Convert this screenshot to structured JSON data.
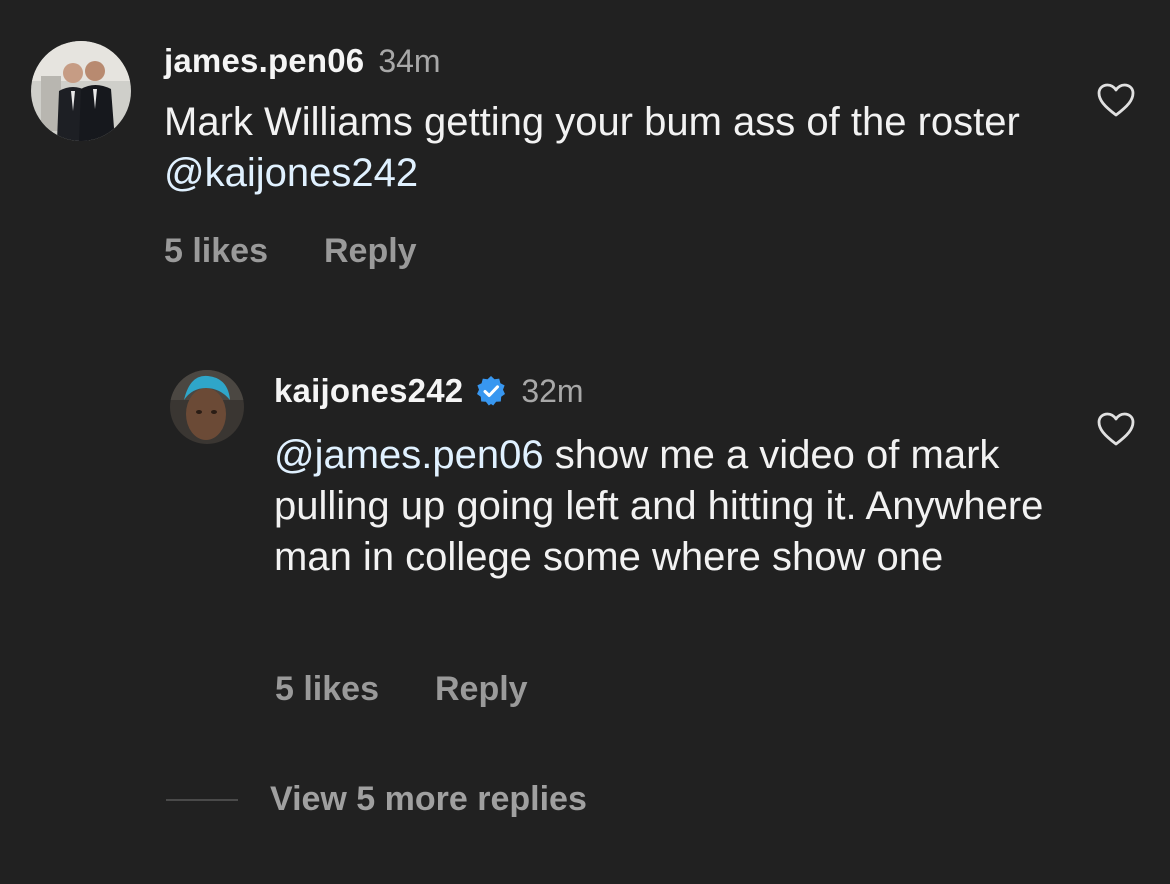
{
  "comments": [
    {
      "username": "james.pen06",
      "time": "34m",
      "text_before": "Mark Williams getting your bum ass of the roster ",
      "mention": "@kaijones242",
      "text_after": "",
      "likes": "5 likes",
      "reply_label": "Reply",
      "avatar": "two-men-in-suits-photo",
      "verified": false
    },
    {
      "username": "kaijones242",
      "time": "32m",
      "mention": "@james.pen06",
      "text_after": " show me a video of mark pulling up going left and hitting it. Anywhere man in college some where show one",
      "likes": "5 likes",
      "reply_label": "Reply",
      "avatar": "man-with-blue-hair-photo",
      "verified": true
    }
  ],
  "view_more_label": "View 5 more replies",
  "icons": {
    "like": "heart-outline-icon",
    "verified": "verified-badge-icon"
  },
  "colors": {
    "background": "#212121",
    "verified_blue": "#3897f0"
  }
}
